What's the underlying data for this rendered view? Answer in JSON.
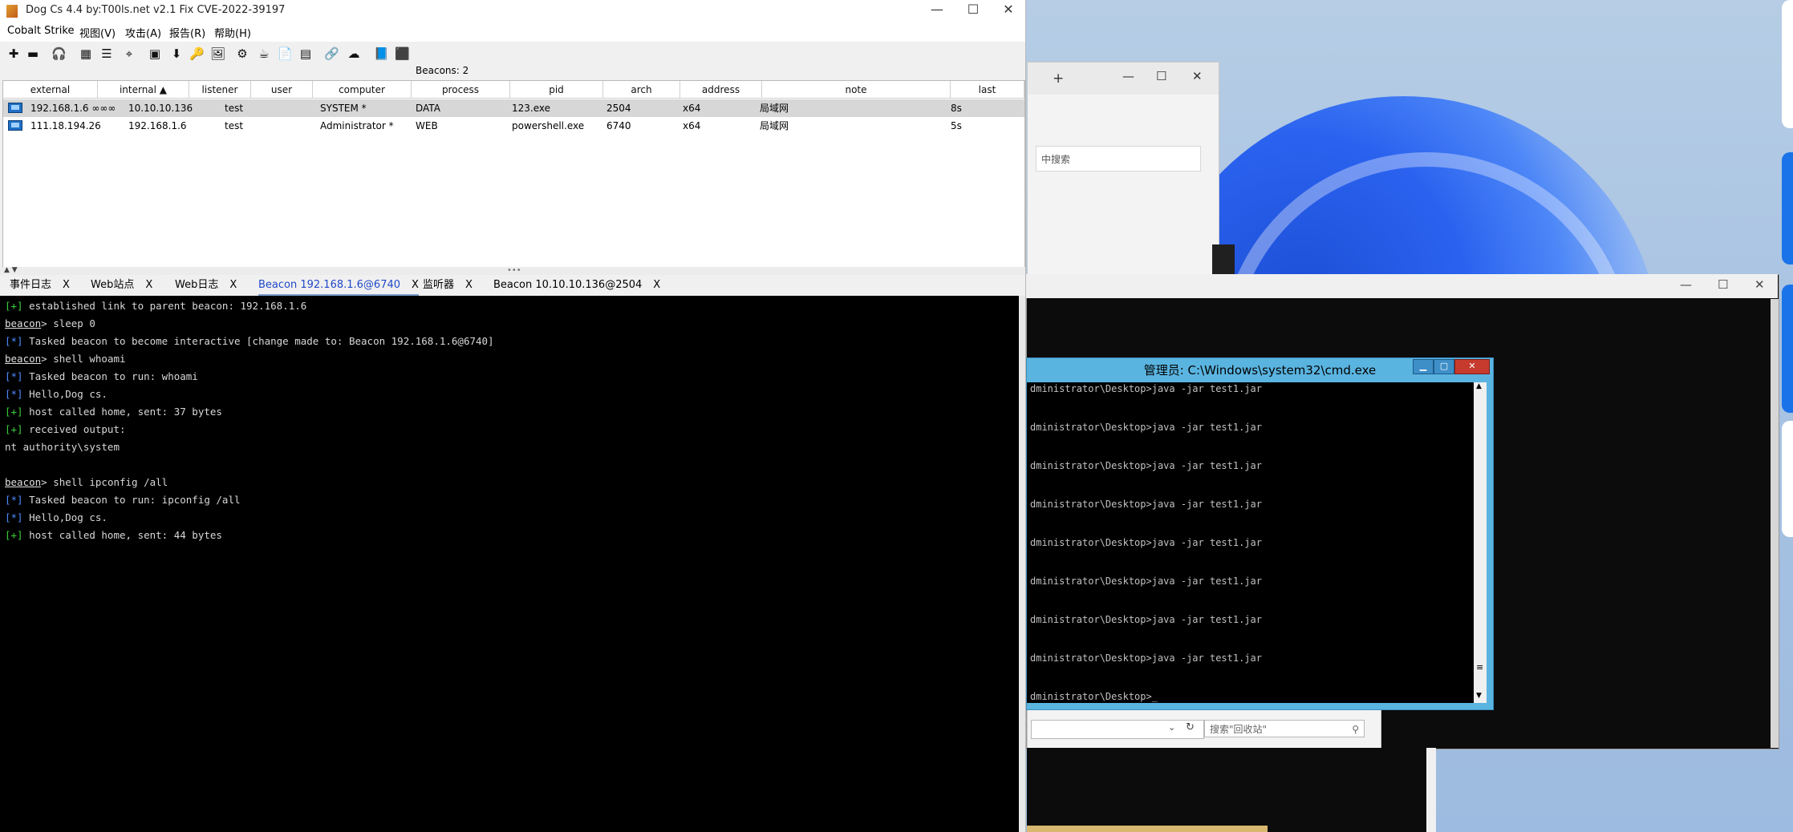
{
  "main_window": {
    "title": "Dog Cs 4.4 by:T00ls.net v2.1 Fix CVE-2022-39197",
    "controls": {
      "minimize": "—",
      "maximize": "☐",
      "close": "✕"
    }
  },
  "menu": [
    "Cobalt Strike",
    "视图(V)",
    "攻击(A)",
    "报告(R)",
    "帮助(H)"
  ],
  "toolbar_icons": [
    "connect-icon",
    "disconnect-icon",
    "headphones-icon",
    "pivot-graph-icon",
    "session-table-icon",
    "target-icon",
    "credentials-icon",
    "download-icon",
    "keys-icon",
    "screenshots-icon",
    "settings-icon",
    "coffee-icon",
    "script-icon",
    "console-icon",
    "link-icon",
    "cloud-icon",
    "book-icon",
    "cube-icon"
  ],
  "toolbar_glyphs": [
    "✚",
    "▬",
    "🎧",
    "▦",
    "☰",
    "⌖",
    "▣",
    "⬇",
    "🔑",
    "🖼",
    "⚙",
    "☕",
    "📄",
    "▤",
    "🔗",
    "☁",
    "📘",
    "⬛"
  ],
  "beacons_label": "Beacons: 2",
  "table": {
    "columns": [
      "external",
      "internal ▲",
      "listener",
      "user",
      "computer",
      "process",
      "pid",
      "arch",
      "address",
      "note",
      "last"
    ],
    "rows": [
      {
        "external": "192.168.1.6 ∞∞∞",
        "internal": "10.10.10.136",
        "listener": "test",
        "user": "SYSTEM *",
        "computer": "DATA",
        "process": "123.exe",
        "pid": "2504",
        "arch": "x64",
        "address": "局域网",
        "note": "",
        "last": "8s"
      },
      {
        "external": "111.18.194.26",
        "internal": "192.168.1.6",
        "listener": "test",
        "user": "Administrator *",
        "computer": "WEB",
        "process": "powershell.exe",
        "pid": "6740",
        "arch": "x64",
        "address": "局域网",
        "note": "",
        "last": "5s"
      }
    ]
  },
  "tabs": [
    {
      "label": "事件日志",
      "close": "X",
      "active": false
    },
    {
      "label": "Web站点",
      "close": "X",
      "active": false
    },
    {
      "label": "Web日志",
      "close": "X",
      "active": false
    },
    {
      "label": "Beacon 192.168.1.6@6740",
      "close": "X",
      "active": true
    },
    {
      "label": "监听器",
      "close": "X",
      "active": false
    },
    {
      "label": "Beacon 10.10.10.136@2504",
      "close": "X",
      "active": false
    }
  ],
  "console": [
    {
      "tag": "[+]",
      "type": "ok",
      "text": " established link to parent beacon: 192.168.1.6"
    },
    {
      "prompt": "beacon",
      "text": "> sleep 0"
    },
    {
      "tag": "[*]",
      "type": "info",
      "text": " Tasked beacon to become interactive [change made to: Beacon 192.168.1.6@6740]"
    },
    {
      "prompt": "beacon",
      "text": "> shell whoami"
    },
    {
      "tag": "[*]",
      "type": "info",
      "text": " Tasked beacon to run: whoami"
    },
    {
      "tag": "[*]",
      "type": "info",
      "text": " Hello,Dog cs."
    },
    {
      "tag": "[+]",
      "type": "ok",
      "text": " host called home, sent: 37 bytes"
    },
    {
      "tag": "[+]",
      "type": "ok",
      "text": " received output:"
    },
    {
      "text": "nt authority\\system"
    },
    {
      "text": ""
    },
    {
      "prompt": "beacon",
      "text": "> shell ipconfig /all"
    },
    {
      "tag": "[*]",
      "type": "info",
      "text": " Tasked beacon to run: ipconfig /all"
    },
    {
      "tag": "[*]",
      "type": "info",
      "text": " Hello,Dog cs."
    },
    {
      "tag": "[+]",
      "type": "ok",
      "text": " host called home, sent: 44 bytes"
    }
  ],
  "cmd_window": {
    "title": "管理员: C:\\Windows\\system32\\cmd.exe",
    "lines": [
      "dministrator\\Desktop>java -jar test1.jar",
      "dministrator\\Desktop>java -jar test1.jar",
      "dministrator\\Desktop>java -jar test1.jar",
      "dministrator\\Desktop>java -jar test1.jar",
      "dministrator\\Desktop>java -jar test1.jar",
      "dministrator\\Desktop>java -jar test1.jar",
      "dministrator\\Desktop>java -jar test1.jar",
      "dministrator\\Desktop>java -jar test1.jar"
    ],
    "prompt": "dministrator\\Desktop>_"
  },
  "explorer": {
    "search_placeholder": "中搜索",
    "plus": "+",
    "recycle_search": "搜索\"回收站\""
  },
  "colors": {
    "console_ok": "#3ad13a",
    "console_info": "#4f8dff",
    "cmd_frame": "#5ab4e0",
    "active_tab": "#2048c8"
  }
}
